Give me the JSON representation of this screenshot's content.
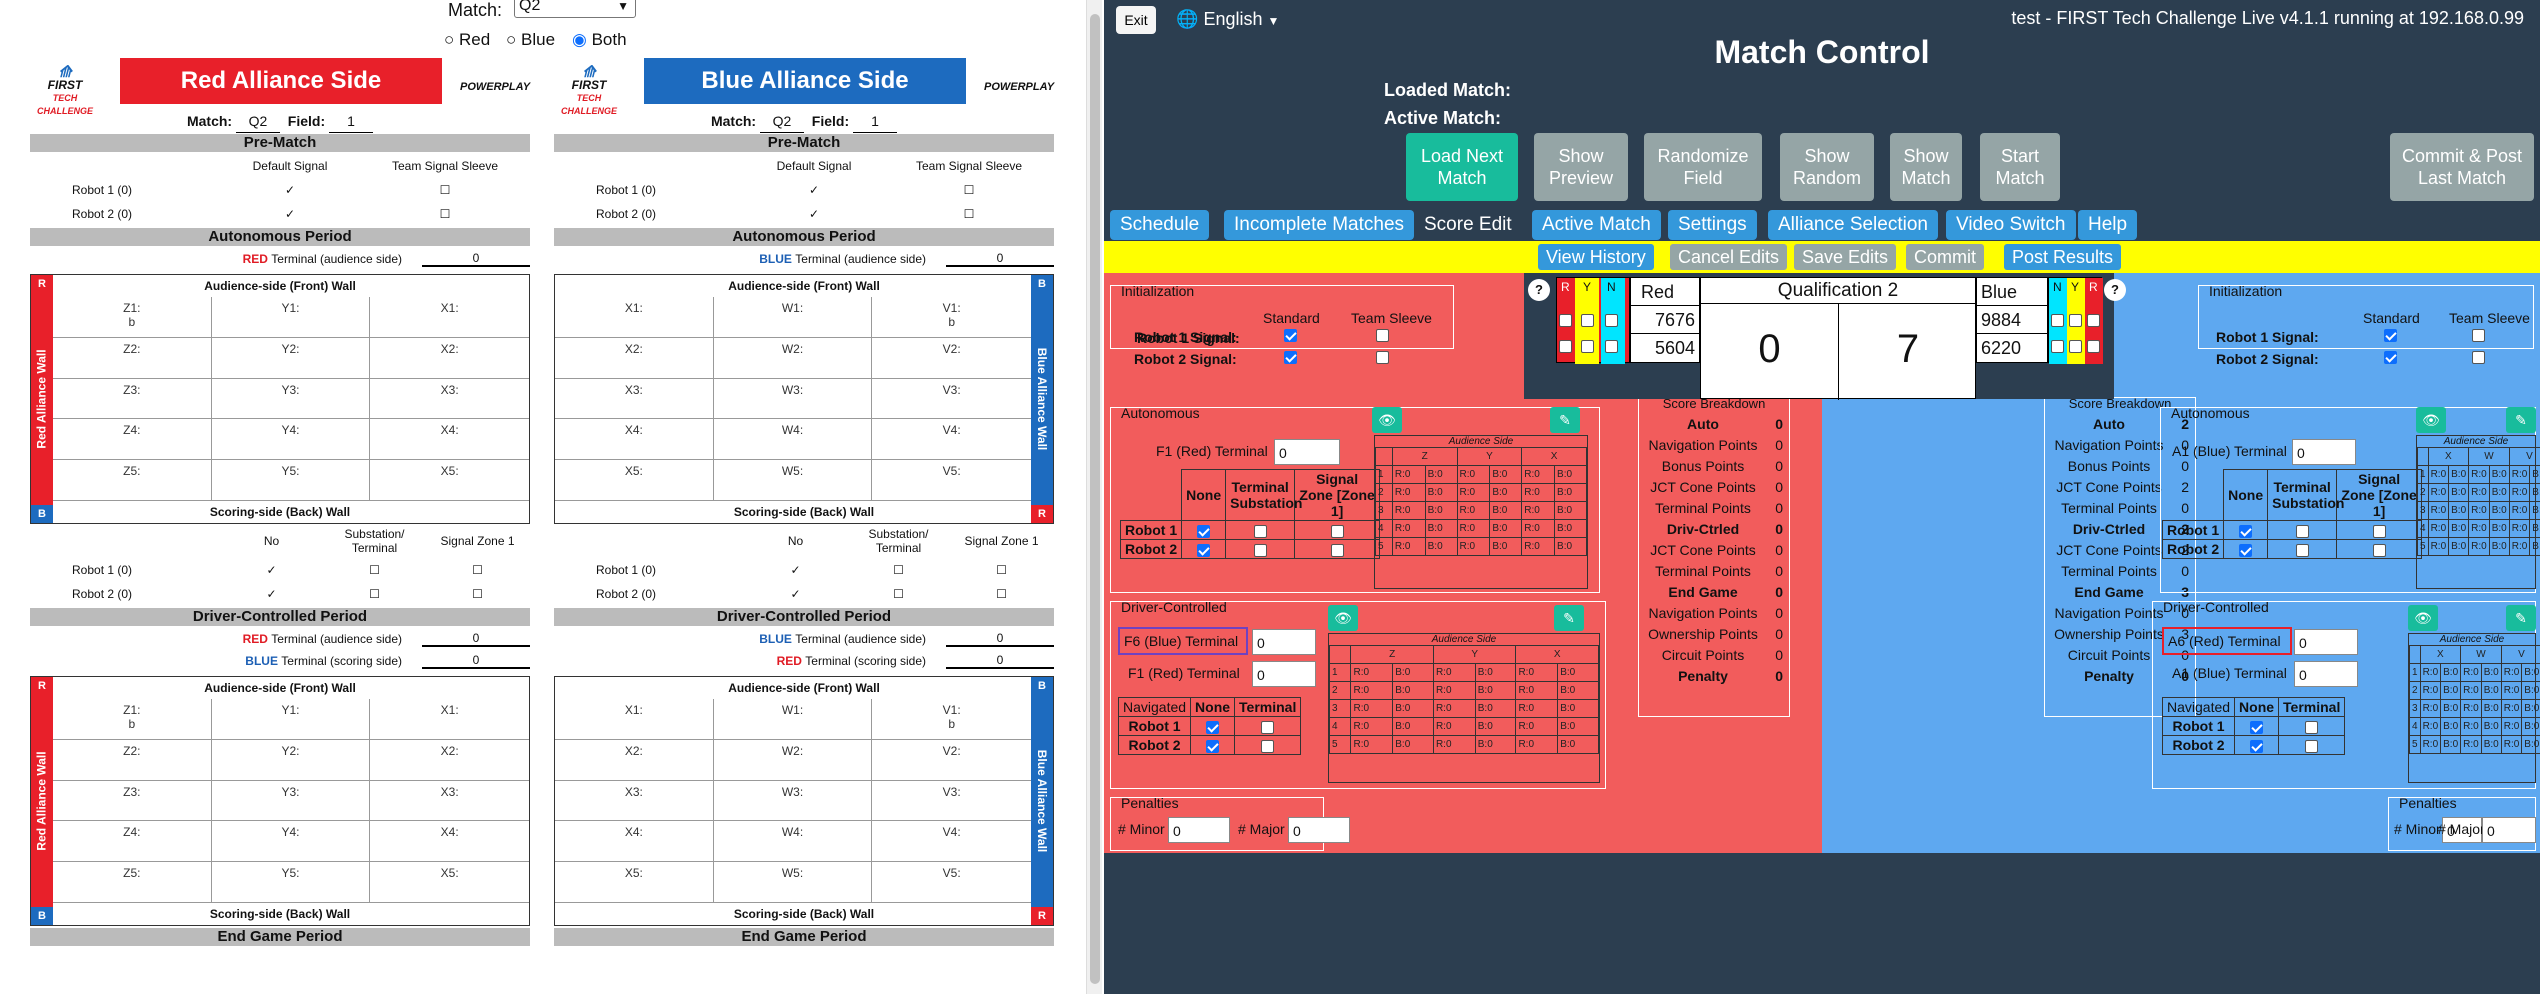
{
  "sheet": {
    "match_label": "Match:",
    "match_select": "Q2",
    "radio": [
      {
        "label": "Red",
        "checked": false
      },
      {
        "label": "Blue",
        "checked": false
      },
      {
        "label": "Both",
        "checked": true
      }
    ],
    "red": {
      "title": "Red Alliance Side",
      "match": "Q2",
      "field": "1",
      "wall": "Red Alliance Wall",
      "color": "#e8202a"
    },
    "blue": {
      "title": "Blue Alliance Side",
      "match": "Q2",
      "field": "1",
      "wall": "Blue Alliance Wall",
      "color": "#1d6bbf"
    },
    "logo_text": "FIRST TECH CHALLENGE",
    "pp_text": "POWERPLAY",
    "match_lbl": "Match:",
    "field_lbl": "Field:",
    "pre_match": "Pre-Match",
    "default_signal": "Default Signal",
    "team_signal": "Team Signal Sleeve",
    "robot1": "Robot 1 (0)",
    "robot2": "Robot 2 (0)",
    "auto_period": "Autonomous Period",
    "red_term_aud": "Terminal (audience side)",
    "red_word": "RED",
    "blue_word": "BLUE",
    "term_scoring": "Terminal (scoring side)",
    "zero": "0",
    "front_wall": "Audience-side (Front) Wall",
    "back_wall": "Scoring-side (Back) Wall",
    "red_grid": [
      "Z1:\nb",
      "Y1:",
      "X1:",
      "Z2:",
      "Y2:",
      "X2:",
      "Z3:",
      "Y3:",
      "X3:",
      "Z4:",
      "Y4:",
      "X4:",
      "Z5:",
      "Y5:",
      "X5:"
    ],
    "blue_grid": [
      "X1:",
      "W1:",
      "V1:\nb",
      "X2:",
      "W2:",
      "V2:",
      "X3:",
      "W3:",
      "V3:",
      "X4:",
      "W4:",
      "V4:",
      "X5:",
      "W5:",
      "V5:"
    ],
    "no": "No",
    "substation": "Substation/ Terminal",
    "signal_zone": "Signal Zone 1",
    "driver_period": "Driver-Controlled Period",
    "end_game": "End Game Period"
  },
  "right": {
    "exit": "Exit",
    "language": "English",
    "version": "test - FIRST Tech Challenge Live v4.1.1 running at 192.168.0.99",
    "title": "Match Control",
    "loaded": "Loaded Match:",
    "active": "Active Match:",
    "buttons": [
      "Load Next Match",
      "Show Preview",
      "Randomize Field",
      "Show Random",
      "Show Match",
      "Start Match",
      "Commit & Post Last Match"
    ],
    "tabs": [
      "Schedule",
      "Incomplete Matches",
      "Score Edit",
      "Active Match",
      "Settings",
      "Alliance Selection",
      "Video Switch",
      "Help"
    ],
    "actions": [
      "View History",
      "Cancel Edits",
      "Save Edits",
      "Commit",
      "Post Results"
    ],
    "qual": "Qualification 2",
    "red_label": "Red",
    "blue_label": "Blue",
    "red_teams": [
      "7676",
      "5604"
    ],
    "blue_teams": [
      "9884",
      "6220"
    ],
    "red_score": "0",
    "blue_score": "7",
    "flags": [
      "R",
      "Y",
      "N"
    ],
    "flags_b": [
      "N",
      "Y",
      "R"
    ],
    "init": "Initialization",
    "standard": "Standard",
    "team_sleeve": "Team Sleeve",
    "r1sig": "Robot 1 Signal:",
    "r2sig": "Robot 2 Signal:",
    "auto": "Autonomous",
    "f1_red_term": "F1 (Red) Terminal",
    "a1_blue_term": "A1 (Blue) Terminal",
    "none": "None",
    "term_sub": "Terminal Substation",
    "sig_zone": "Signal Zone [Zone 1]",
    "r1": "Robot 1",
    "r2": "Robot 2",
    "audience_side": "Audience Side",
    "driver": "Driver-Controlled",
    "f6_blue": "F6 (Blue) Terminal",
    "a6_red": "A6 (Red) Terminal",
    "navigated": "Navigated",
    "terminal": "Terminal",
    "penalties": "Penalties",
    "minor": "# Minor",
    "major": "# Major",
    "breakdown": "Score Breakdown",
    "red_bd": [
      [
        "Auto",
        "0"
      ],
      [
        "Navigation Points",
        "0"
      ],
      [
        "Bonus Points",
        "0"
      ],
      [
        "JCT Cone Points",
        "0"
      ],
      [
        "Terminal Points",
        "0"
      ],
      [
        "Driv-Ctrled",
        "0"
      ],
      [
        "JCT Cone Points",
        "0"
      ],
      [
        "Terminal Points",
        "0"
      ],
      [
        "End Game",
        "0"
      ],
      [
        "Navigation Points",
        "0"
      ],
      [
        "Ownership Points",
        "0"
      ],
      [
        "Circuit Points",
        "0"
      ],
      [
        "Penalty",
        "0"
      ]
    ],
    "blue_bd": [
      [
        "Auto",
        "2"
      ],
      [
        "Navigation Points",
        "0"
      ],
      [
        "Bonus Points",
        "0"
      ],
      [
        "JCT Cone Points",
        "2"
      ],
      [
        "Terminal Points",
        "0"
      ],
      [
        "Driv-Ctrled",
        "2"
      ],
      [
        "JCT Cone Points",
        "2"
      ],
      [
        "Terminal Points",
        "0"
      ],
      [
        "End Game",
        "3"
      ],
      [
        "Navigation Points",
        "0"
      ],
      [
        "Ownership Points",
        "3"
      ],
      [
        "Circuit Points",
        "0"
      ],
      [
        "Penalty",
        "0"
      ]
    ],
    "zero": "0",
    "red_cols": [
      "Z",
      "Y",
      "X"
    ],
    "blue_cols": [
      "X",
      "W",
      "V"
    ],
    "cell": "R:0  B:0",
    "cell_b1": "R:0  B:1"
  }
}
